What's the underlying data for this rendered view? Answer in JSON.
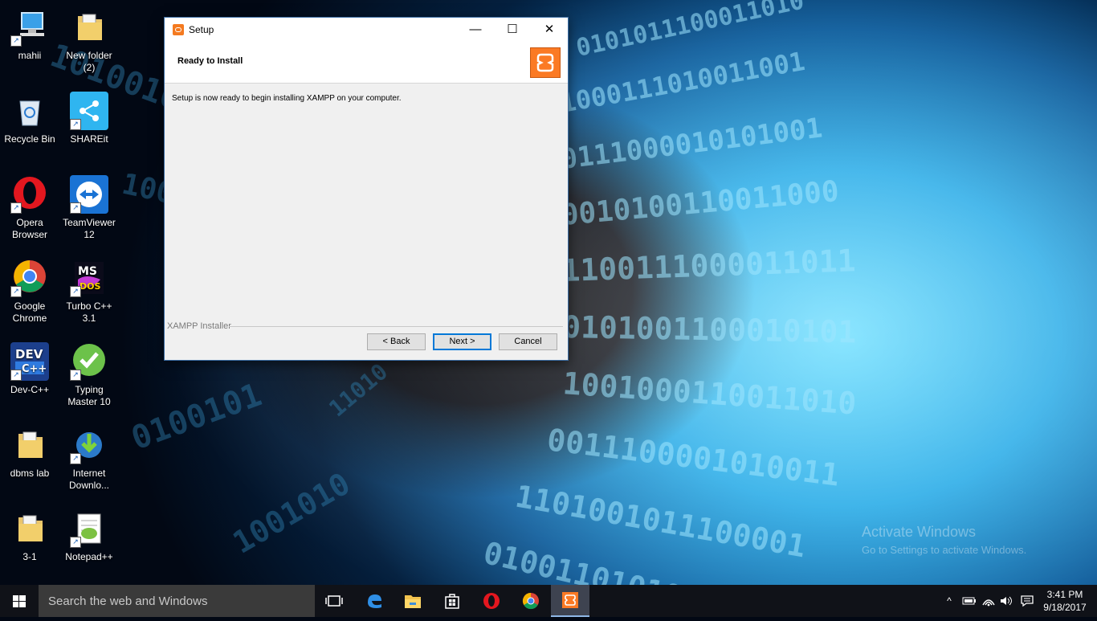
{
  "desktop": {
    "icons": [
      {
        "label": "mahii"
      },
      {
        "label": "New folder (2)"
      },
      {
        "label": "Recycle Bin"
      },
      {
        "label": "SHAREit"
      },
      {
        "label": "Opera Browser"
      },
      {
        "label": "TeamViewer 12"
      },
      {
        "label": "Google Chrome"
      },
      {
        "label": "Turbo C++ 3.1"
      },
      {
        "label": "Dev-C++"
      },
      {
        "label": "Typing Master 10"
      },
      {
        "label": "dbms lab"
      },
      {
        "label": "Internet Downlo..."
      },
      {
        "label": "3-1"
      },
      {
        "label": "Notepad++"
      }
    ],
    "watermark": {
      "line1": "Activate Windows",
      "line2": "Go to Settings to activate Windows."
    }
  },
  "window": {
    "title": "Setup",
    "header_title": "Ready to Install",
    "message": "Setup is now ready to begin installing XAMPP on your computer.",
    "group_label": "XAMPP Installer",
    "buttons": {
      "back": "< Back",
      "next": "Next >",
      "cancel": "Cancel"
    },
    "logo_color": "#fb7a24"
  },
  "taskbar": {
    "search_placeholder": "Search the web and Windows",
    "pinned": [
      "task-view-icon",
      "edge-icon",
      "file-explorer-icon",
      "store-icon",
      "opera-icon",
      "chrome-icon",
      "xampp-icon"
    ],
    "time": "3:41 PM",
    "date": "9/18/2017"
  }
}
